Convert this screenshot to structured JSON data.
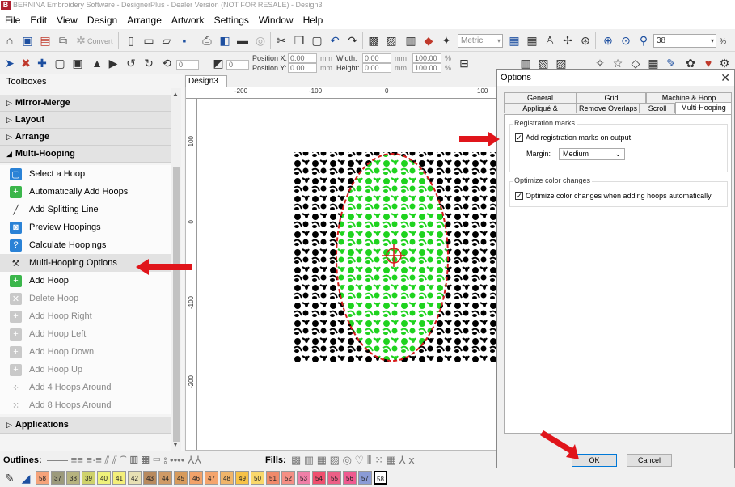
{
  "window": {
    "title": "BERNINA Embroidery Software - DesignerPlus - Dealer Version (NOT FOR RESALE) - Design3",
    "app_icon": "B"
  },
  "menu": [
    "File",
    "Edit",
    "View",
    "Design",
    "Arrange",
    "Artwork",
    "Settings",
    "Window",
    "Help"
  ],
  "toolbar1": {
    "convert_label": "Convert",
    "metric_label": "Metric",
    "zoom_value": "38",
    "zoom_unit": "%"
  },
  "toolbar2": {
    "pos_x_label": "Position X:",
    "pos_x_value": "0.00",
    "pos_y_label": "Position Y:",
    "pos_y_value": "0.00",
    "width_label": "Width:",
    "width_value": "0.00",
    "height_label": "Height:",
    "height_value": "0.00",
    "scale_w": "100.00",
    "scale_h": "100.00",
    "unit_mm": "mm",
    "unit_pct": "%"
  },
  "toolboxes": {
    "header": "Toolboxes",
    "sections": {
      "mirror_merge": "Mirror-Merge",
      "layout": "Layout",
      "arrange": "Arrange",
      "multi_hooping": "Multi-Hooping",
      "applications": "Applications"
    },
    "items": [
      {
        "label": "Select a Hoop",
        "icon": "select-hoop-icon"
      },
      {
        "label": "Automatically Add Hoops",
        "icon": "auto-add-hoops-icon"
      },
      {
        "label": "Add Splitting Line",
        "icon": "splitting-line-icon"
      },
      {
        "label": "Preview Hoopings",
        "icon": "preview-hoopings-icon"
      },
      {
        "label": "Calculate Hoopings",
        "icon": "calculate-hoopings-icon"
      },
      {
        "label": "Multi-Hooping Options",
        "icon": "tools-icon"
      },
      {
        "label": "Add Hoop",
        "icon": "add-hoop-icon"
      },
      {
        "label": "Delete Hoop",
        "icon": "delete-hoop-icon"
      },
      {
        "label": "Add Hoop Right",
        "icon": "hoop-right-icon"
      },
      {
        "label": "Add Hoop Left",
        "icon": "hoop-left-icon"
      },
      {
        "label": "Add Hoop Down",
        "icon": "hoop-down-icon"
      },
      {
        "label": "Add Hoop Up",
        "icon": "hoop-up-icon"
      },
      {
        "label": "Add 4 Hoops Around",
        "icon": "four-hoops-icon"
      },
      {
        "label": "Add 8 Hoops Around",
        "icon": "eight-hoops-icon"
      }
    ]
  },
  "canvas": {
    "tab_label": "Design3",
    "ruler_top": [
      "-200",
      "-100",
      "0",
      "100"
    ],
    "ruler_left": [
      "100",
      "0",
      "-100",
      "-200"
    ]
  },
  "outlines_bar": {
    "outlines_label": "Outlines:",
    "fills_label": "Fills:"
  },
  "palette": {
    "swatches": [
      {
        "num": "58",
        "color": "#f5a37a"
      },
      {
        "num": "37",
        "color": "#9c9a7c"
      },
      {
        "num": "38",
        "color": "#b6b37f"
      },
      {
        "num": "39",
        "color": "#cfd26c"
      },
      {
        "num": "40",
        "color": "#eef27b"
      },
      {
        "num": "41",
        "color": "#f4ef7a"
      },
      {
        "num": "42",
        "color": "#e7e0b4"
      },
      {
        "num": "43",
        "color": "#b88a5e"
      },
      {
        "num": "44",
        "color": "#cf9a66"
      },
      {
        "num": "45",
        "color": "#d79b5c"
      },
      {
        "num": "46",
        "color": "#f1a26a"
      },
      {
        "num": "47",
        "color": "#f4a56d"
      },
      {
        "num": "48",
        "color": "#f0b56a"
      },
      {
        "num": "49",
        "color": "#f7c247"
      },
      {
        "num": "50",
        "color": "#f9d86b"
      },
      {
        "num": "51",
        "color": "#f08a6a"
      },
      {
        "num": "52",
        "color": "#f58f84"
      },
      {
        "num": "53",
        "color": "#ef7fa7"
      },
      {
        "num": "54",
        "color": "#f04f6e"
      },
      {
        "num": "55",
        "color": "#ec5f86"
      },
      {
        "num": "56",
        "color": "#f05a90"
      },
      {
        "num": "57",
        "color": "#8a9bd6"
      },
      {
        "num": "58",
        "color": "#ffffff"
      }
    ]
  },
  "dialog": {
    "title": "Options",
    "tabs_row1": [
      "General",
      "Grid",
      "Machine & Hoop"
    ],
    "tabs_row2": [
      "Appliqué & PunchWork",
      "Remove Overlaps",
      "Scroll",
      "Multi-Hooping"
    ],
    "registration_group": "Registration marks",
    "add_reg_marks_label": "Add registration marks on output",
    "add_reg_marks_checked": true,
    "margin_label": "Margin:",
    "margin_value": "Medium",
    "optimize_group": "Optimize color changes",
    "optimize_label": "Optimize color changes when adding hoops automatically",
    "optimize_checked": true,
    "ok_label": "OK",
    "cancel_label": "Cancel"
  },
  "colors": {
    "accent_arrow": "#e0151b",
    "embroidery_green": "#1fd31f",
    "hoop_red": "#d71a1a"
  }
}
